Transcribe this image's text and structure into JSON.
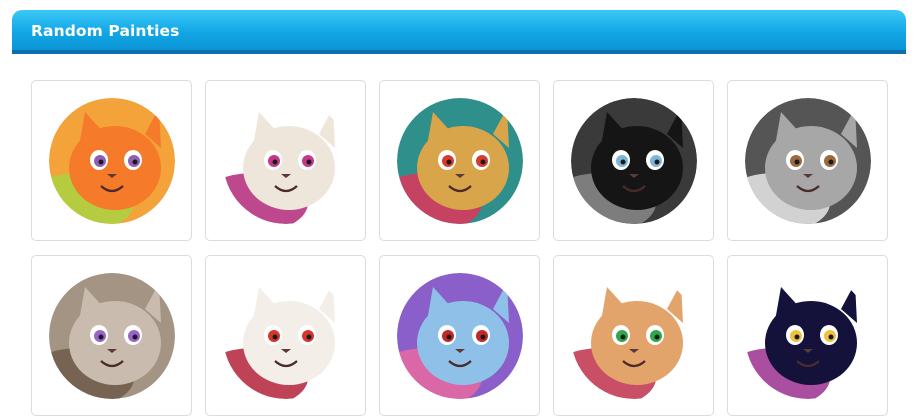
{
  "header": {
    "title": "Random Painties"
  },
  "painties": [
    {
      "icon": "orange-cat-painty",
      "colors": {
        "bg": "#f3a33a",
        "skin": "#f57b2b",
        "accent": "#a9d343",
        "eye": "#8f5fb8"
      }
    },
    {
      "icon": "cream-dragon-painty",
      "colors": {
        "bg": "#ffffff",
        "skin": "#efe6db",
        "accent": "#b1287a",
        "eye": "#c2398a"
      }
    },
    {
      "icon": "flower-dino-painty",
      "colors": {
        "bg": "#2f8f8a",
        "skin": "#d8a54b",
        "accent": "#e0355a",
        "eye": "#d53b2e"
      }
    },
    {
      "icon": "dark-elf-painty",
      "colors": {
        "bg": "#3a3a3a",
        "skin": "#151515",
        "accent": "#8a8a8a",
        "eye": "#7fb6d8"
      }
    },
    {
      "icon": "gray-cat-painty",
      "colors": {
        "bg": "#555555",
        "skin": "#a7a7a7",
        "accent": "#e9e9e9",
        "eye": "#9b6b3f"
      }
    },
    {
      "icon": "owl-painty",
      "colors": {
        "bg": "#a39483",
        "skin": "#c9bcae",
        "accent": "#6f5a4a",
        "eye": "#9a63c9"
      }
    },
    {
      "icon": "white-creature-painty",
      "colors": {
        "bg": "#ffffff",
        "skin": "#f3eee8",
        "accent": "#b3223a",
        "eye": "#d6362a"
      }
    },
    {
      "icon": "purple-beast-painty",
      "colors": {
        "bg": "#8a5fc9",
        "skin": "#8fc1e8",
        "accent": "#e76aa0",
        "eye": "#c0282a"
      }
    },
    {
      "icon": "moth-painty",
      "colors": {
        "bg": "#ffffff",
        "skin": "#e3a46b",
        "accent": "#c0304b",
        "eye": "#2ea84a"
      }
    },
    {
      "icon": "black-cat-painty",
      "colors": {
        "bg": "#ffffff",
        "skin": "#14113b",
        "accent": "#9b2f8f",
        "eye": "#f0c040"
      }
    }
  ]
}
